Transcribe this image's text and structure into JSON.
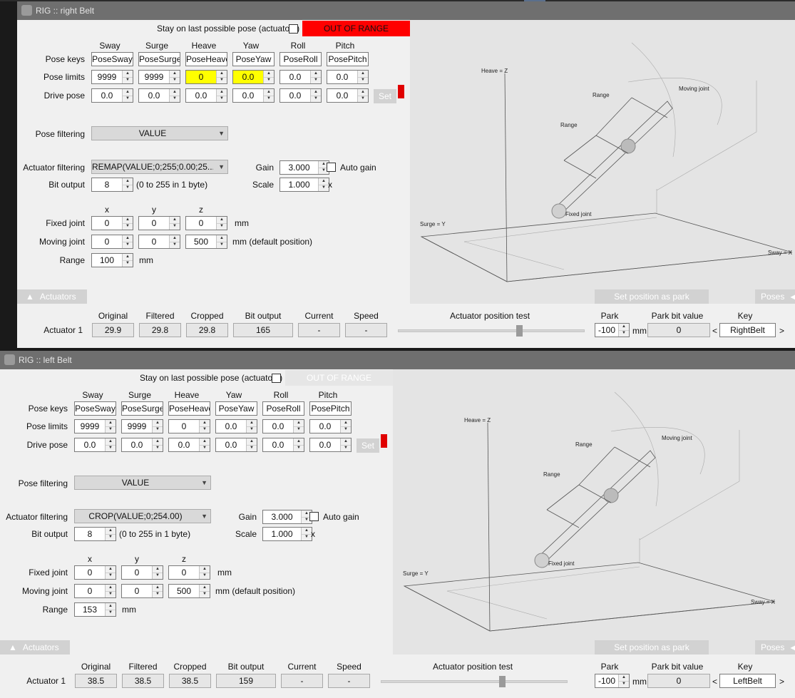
{
  "windows": [
    {
      "id": "right",
      "title": "RIG :: right Belt",
      "stay_label": "Stay on last possible pose (actuators)",
      "stay_checked": false,
      "out_of_range": {
        "label": "OUT OF RANGE",
        "active": true,
        "color": "#ff0000"
      },
      "axes": [
        "Sway",
        "Surge",
        "Heave",
        "Yaw",
        "Roll",
        "Pitch"
      ],
      "pose_keys_label": "Pose keys",
      "pose_keys": [
        "PoseSway",
        "PoseSurge",
        "PoseHeave",
        "PoseYaw",
        "PoseRoll",
        "PosePitch"
      ],
      "pose_limits_label": "Pose limits",
      "pose_limits": [
        "9999",
        "9999",
        "0",
        "0.0",
        "0.0",
        "0.0"
      ],
      "pose_limits_highlight": [
        false,
        false,
        true,
        true,
        false,
        false
      ],
      "highlight_color": "#ffff00",
      "drive_pose_label": "Drive pose",
      "drive_pose": [
        "0.0",
        "0.0",
        "0.0",
        "0.0",
        "0.0",
        "0.0"
      ],
      "set_label": "Set",
      "pose_filtering_label": "Pose filtering",
      "pose_filtering_value": "VALUE",
      "actuator_filtering_label": "Actuator filtering",
      "actuator_filtering_value": "REMAP(VALUE;0;255;0.00;25...",
      "gain_label": "Gain",
      "gain_value": "3.000",
      "auto_gain_label": "Auto gain",
      "auto_gain_checked": false,
      "bit_output_label": "Bit output",
      "bit_output_value": "8",
      "bit_output_hint": "(0 to 255 in 1 byte)",
      "scale_label": "Scale",
      "scale_value": "1.000",
      "scale_unit": "x",
      "xyz": [
        "x",
        "y",
        "z"
      ],
      "fixed_joint_label": "Fixed joint",
      "fixed_joint": [
        "0",
        "0",
        "0"
      ],
      "fixed_unit": "mm",
      "moving_joint_label": "Moving joint",
      "moving_joint": [
        "0",
        "0",
        "500"
      ],
      "moving_unit": "mm (default position)",
      "range_label": "Range",
      "range_value": "100",
      "range_unit": "mm",
      "view": {
        "heave_axis": "Heave = Z",
        "surge_axis": "Surge = Y",
        "sway_axis": "Sway = X",
        "moving_joint": "Moving joint",
        "fixed_joint": "Fixed joint",
        "range_a": "Range",
        "range_b": "Range"
      },
      "actuators_tab": "Actuators",
      "set_park_label": "Set position as park",
      "poses_tab": "Poses",
      "table": {
        "headers": [
          "Original",
          "Filtered",
          "Cropped",
          "Bit output",
          "Current",
          "Speed"
        ],
        "row_label": "Actuator 1",
        "values": [
          "29.9",
          "29.8",
          "29.8",
          "165",
          "-",
          "-"
        ],
        "position_test_label": "Actuator position test",
        "position_test_level": 0.65,
        "park_label": "Park",
        "park_value": "-100",
        "park_unit": "mm",
        "park_bit_label": "Park bit value",
        "park_bit_value": "0",
        "key_label": "Key",
        "key_value": "RightBelt",
        "lt": "<",
        "gt": ">"
      }
    },
    {
      "id": "left",
      "title": "RIG :: left Belt",
      "stay_label": "Stay on last possible pose (actuators)",
      "stay_checked": false,
      "out_of_range": {
        "label": "OUT OF RANGE",
        "active": false,
        "color": "#e6e6e6"
      },
      "axes": [
        "Sway",
        "Surge",
        "Heave",
        "Yaw",
        "Roll",
        "Pitch"
      ],
      "pose_keys_label": "Pose keys",
      "pose_keys": [
        "PoseSway",
        "PoseSurge",
        "PoseHeave",
        "PoseYaw",
        "PoseRoll",
        "PosePitch"
      ],
      "pose_limits_label": "Pose limits",
      "pose_limits": [
        "9999",
        "9999",
        "0",
        "0.0",
        "0.0",
        "0.0"
      ],
      "pose_limits_highlight": [
        false,
        false,
        false,
        false,
        false,
        false
      ],
      "highlight_color": "#ffff00",
      "drive_pose_label": "Drive pose",
      "drive_pose": [
        "0.0",
        "0.0",
        "0.0",
        "0.0",
        "0.0",
        "0.0"
      ],
      "set_label": "Set",
      "pose_filtering_label": "Pose filtering",
      "pose_filtering_value": "VALUE",
      "actuator_filtering_label": "Actuator filtering",
      "actuator_filtering_value": "CROP(VALUE;0;254.00)",
      "gain_label": "Gain",
      "gain_value": "3.000",
      "auto_gain_label": "Auto gain",
      "auto_gain_checked": false,
      "bit_output_label": "Bit output",
      "bit_output_value": "8",
      "bit_output_hint": "(0 to 255 in 1 byte)",
      "scale_label": "Scale",
      "scale_value": "1.000",
      "scale_unit": "x",
      "xyz": [
        "x",
        "y",
        "z"
      ],
      "fixed_joint_label": "Fixed joint",
      "fixed_joint": [
        "0",
        "0",
        "0"
      ],
      "fixed_unit": "mm",
      "moving_joint_label": "Moving joint",
      "moving_joint": [
        "0",
        "0",
        "500"
      ],
      "moving_unit": "mm (default position)",
      "range_label": "Range",
      "range_value": "153",
      "range_unit": "mm",
      "view": {
        "heave_axis": "Heave = Z",
        "surge_axis": "Surge = Y",
        "sway_axis": "Sway = X",
        "moving_joint": "Moving joint",
        "fixed_joint": "Fixed joint",
        "range_a": "Range",
        "range_b": "Range"
      },
      "actuators_tab": "Actuators",
      "set_park_label": "Set position as park",
      "poses_tab": "Poses",
      "table": {
        "headers": [
          "Original",
          "Filtered",
          "Cropped",
          "Bit output",
          "Current",
          "Speed"
        ],
        "row_label": "Actuator 1",
        "values": [
          "38.5",
          "38.5",
          "38.5",
          "159",
          "-",
          "-"
        ],
        "position_test_label": "Actuator position test",
        "position_test_level": 0.65,
        "park_label": "Park",
        "park_value": "-100",
        "park_unit": "mm",
        "park_bit_label": "Park bit value",
        "park_bit_value": "0",
        "key_label": "Key",
        "key_value": "LeftBelt",
        "lt": "<",
        "gt": ">"
      }
    }
  ]
}
